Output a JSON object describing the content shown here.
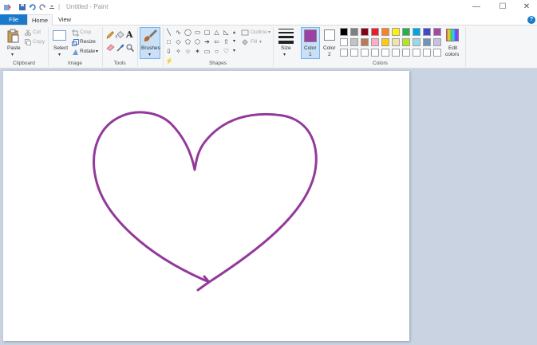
{
  "window": {
    "title": "Untitled - Paint",
    "separator": "|",
    "minimize_glyph": "—",
    "maximize_glyph": "☐",
    "close_glyph": "✕"
  },
  "tabs": {
    "file": "File",
    "home": "Home",
    "view": "View",
    "help_glyph": "?"
  },
  "clipboard": {
    "paste": "Paste",
    "cut": "Cut",
    "copy": "Copy",
    "label": "Clipboard"
  },
  "image": {
    "select": "Select",
    "crop": "Crop",
    "resize": "Resize",
    "rotate": "Rotate",
    "label": "Image"
  },
  "tools": {
    "label": "Tools",
    "text_glyph": "A"
  },
  "brushes": {
    "label": "Brushes"
  },
  "shapes": {
    "outline": "Outline",
    "fill": "Fill",
    "label": "Shapes",
    "glyphs": [
      "╲",
      "∿",
      "◯",
      "▭",
      "▢",
      "△",
      "◺",
      "□",
      "◇",
      "⬠",
      "⬡",
      "➔",
      "⇦",
      "⇧",
      "⇩",
      "✧",
      "☆",
      "✶",
      "▭",
      "○",
      "♡",
      "⚡"
    ]
  },
  "size": {
    "label": "Size"
  },
  "color1": {
    "label": "Color",
    "num": "1",
    "value": "#9c3fa6"
  },
  "color2": {
    "label": "Color",
    "num": "2",
    "value": "#ffffff"
  },
  "palette": {
    "row1": [
      "#000000",
      "#7f7f7f",
      "#880015",
      "#ed1c24",
      "#ff7f27",
      "#fff200",
      "#22b14c",
      "#00a2e8",
      "#3f48cc",
      "#a349a4"
    ],
    "row2": [
      "#ffffff",
      "#c3c3c3",
      "#b97a57",
      "#ffaec9",
      "#ffc90e",
      "#efe4b0",
      "#b5e61d",
      "#99d9ea",
      "#7092be",
      "#c8bfe7"
    ],
    "row3": [
      "#ffffff",
      "#ffffff",
      "#ffffff",
      "#ffffff",
      "#ffffff",
      "#ffffff",
      "#ffffff",
      "#ffffff",
      "#ffffff",
      "#ffffff"
    ],
    "label": "Colors"
  },
  "edit_colors": {
    "line1": "Edit",
    "line2": "colors"
  },
  "drawing": {
    "shape": "heart",
    "stroke_color": "#93399c"
  }
}
